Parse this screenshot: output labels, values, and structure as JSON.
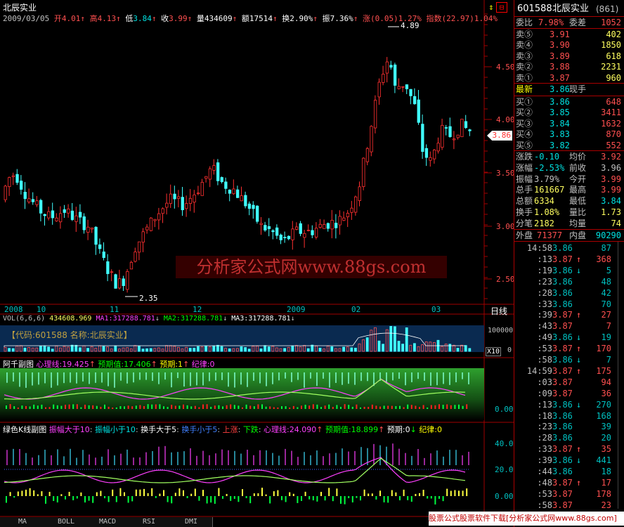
{
  "stock_name": "北辰实业",
  "header": {
    "date": "2009/03/05",
    "open_label": "开",
    "open": "4.01",
    "high_label": "高",
    "high": "4.13",
    "low_label": "低",
    "low": "3.84",
    "close_label": "收",
    "close": "3.99",
    "vol_label": "量",
    "vol": "434609",
    "amt_label": "额",
    "amt": "17514",
    "turn_label": "换",
    "turn": "2.90%",
    "amp_label": "振",
    "amp": "7.36%",
    "chg_label": "涨",
    "chg": "(0.05)",
    "chg_pct": "1.27%",
    "index_label": "指数",
    "index": "(22.97)",
    "index_pct": "1.04%"
  },
  "price_axis": [
    "4.50",
    "4.00",
    "3.50",
    "3.00",
    "2.50"
  ],
  "price_current": "3.86",
  "high_annot": "4.89",
  "low_annot": "2.35",
  "watermark": "分析家公式网www.88gs.com",
  "date_labels": [
    "2008",
    "10",
    "11",
    "12",
    "2009",
    "02",
    "03"
  ],
  "period_label": "日线",
  "vol_panel": {
    "title": "VOL(6,6,6)",
    "vol": "434608.969",
    "ma1_label": "MA1:",
    "ma1": "317288.781",
    "ma2_label": "MA2:",
    "ma2": "317288.781",
    "ma3_label": "MA3:",
    "ma3": "317288.781",
    "info": "【代码:601588 名称:北辰实业】",
    "axis_top": "100000",
    "axis_bottom": "0",
    "unit": "X10"
  },
  "ind1": {
    "name": "阿千副图",
    "l1": "心理线:19.425",
    "l2": "预期值:17.406",
    "l3": "预期:1",
    "l4": "纪律:0",
    "axis": "0.00"
  },
  "ind2": {
    "name": "绿色K线副图",
    "l1": "振幅大于10",
    "l2": "振幅小于10",
    "l3": "换手大于5",
    "l4": "换手小于5",
    "l5": "上涨",
    "l6": "下跌",
    "l7": "心理线:24.090",
    "l8": "预期值:18.899",
    "l9": "预期:0",
    "l10": "纪律:0",
    "axis": [
      "40.00",
      "20.00",
      "0.00"
    ]
  },
  "panel": {
    "code": "601588",
    "name": "北辰实业",
    "num": "(861)",
    "webi_label": "委比",
    "webi": "7.98%",
    "weicha_label": "委差",
    "weicha": "1052",
    "asks": [
      {
        "label": "卖⑤",
        "price": "3.91",
        "vol": "402"
      },
      {
        "label": "卖④",
        "price": "3.90",
        "vol": "1850"
      },
      {
        "label": "卖③",
        "price": "3.89",
        "vol": "618"
      },
      {
        "label": "卖②",
        "price": "3.88",
        "vol": "2231"
      },
      {
        "label": "卖①",
        "price": "3.87",
        "vol": "960"
      }
    ],
    "latest_label": "最新",
    "latest": "3.86",
    "xianshou_label": "现手",
    "bids": [
      {
        "label": "买①",
        "price": "3.86",
        "vol": "648"
      },
      {
        "label": "买②",
        "price": "3.85",
        "vol": "3411"
      },
      {
        "label": "买③",
        "price": "3.84",
        "vol": "1632"
      },
      {
        "label": "买④",
        "price": "3.83",
        "vol": "870"
      },
      {
        "label": "买⑤",
        "price": "3.82",
        "vol": "552"
      }
    ],
    "stats": [
      {
        "l1": "涨跌",
        "v1": "-0.10",
        "l2": "均价",
        "v2": "3.92"
      },
      {
        "l1": "涨幅",
        "v1": "-2.53%",
        "l2": "前收",
        "v2": "3.96"
      },
      {
        "l1": "振幅",
        "v1": "3.79%",
        "l2": "今开",
        "v2": "3.99"
      },
      {
        "l1": "总手",
        "v1": "161667",
        "l2": "最高",
        "v2": "3.99"
      },
      {
        "l1": "总额",
        "v1": "6334",
        "l2": "最低",
        "v2": "3.84"
      },
      {
        "l1": "换手",
        "v1": "1.08%",
        "l2": "量比",
        "v2": "1.73"
      },
      {
        "l1": "分笔",
        "v1": "2182",
        "l2": "均量",
        "v2": "74"
      }
    ],
    "waipan_label": "外盘",
    "waipan": "71377",
    "neipan_label": "内盘",
    "neipan": "90290",
    "ticks": [
      {
        "t": "14:58",
        "p": "3.86",
        "a": "",
        "v": "87",
        "c": "#00c0c0"
      },
      {
        "t": ":13",
        "p": "3.87",
        "a": "↑",
        "v": "368",
        "c": "#ff5050"
      },
      {
        "t": ":19",
        "p": "3.86",
        "a": "↓",
        "v": "5",
        "c": "#00c0c0"
      },
      {
        "t": ":23",
        "p": "3.86",
        "a": "",
        "v": "48",
        "c": "#00c0c0"
      },
      {
        "t": ":28",
        "p": "3.86",
        "a": "",
        "v": "42",
        "c": "#00c0c0"
      },
      {
        "t": ":33",
        "p": "3.86",
        "a": "",
        "v": "70",
        "c": "#00c0c0"
      },
      {
        "t": ":39",
        "p": "3.87",
        "a": "↑",
        "v": "27",
        "c": "#ff5050"
      },
      {
        "t": ":43",
        "p": "3.87",
        "a": "",
        "v": "7",
        "c": "#ff5050"
      },
      {
        "t": ":49",
        "p": "3.86",
        "a": "↓",
        "v": "19",
        "c": "#00c0c0"
      },
      {
        "t": ":53",
        "p": "3.87",
        "a": "↑",
        "v": "170",
        "c": "#ff5050"
      },
      {
        "t": ":58",
        "p": "3.86",
        "a": "↓",
        "v": "7",
        "c": "#00c0c0"
      },
      {
        "t": "14:59",
        "p": "3.87",
        "a": "↑",
        "v": "175",
        "c": "#ff5050"
      },
      {
        "t": ":03",
        "p": "3.87",
        "a": "",
        "v": "94",
        "c": "#ff5050"
      },
      {
        "t": ":09",
        "p": "3.87",
        "a": "",
        "v": "36",
        "c": "#ff5050"
      },
      {
        "t": ":13",
        "p": "3.86",
        "a": "↓",
        "v": "270",
        "c": "#00c0c0"
      },
      {
        "t": ":18",
        "p": "3.86",
        "a": "",
        "v": "168",
        "c": "#00c0c0"
      },
      {
        "t": ":23",
        "p": "3.86",
        "a": "",
        "v": "39",
        "c": "#00c0c0"
      },
      {
        "t": ":28",
        "p": "3.86",
        "a": "",
        "v": "20",
        "c": "#00c0c0"
      },
      {
        "t": ":33",
        "p": "3.87",
        "a": "↑",
        "v": "35",
        "c": "#ff5050"
      },
      {
        "t": ":39",
        "p": "3.86",
        "a": "↓",
        "v": "441",
        "c": "#00c0c0"
      },
      {
        "t": ":44",
        "p": "3.86",
        "a": "",
        "v": "18",
        "c": "#00c0c0"
      },
      {
        "t": ":48",
        "p": "3.87",
        "a": "↑",
        "v": "17",
        "c": "#ff5050"
      },
      {
        "t": ":53",
        "p": "3.87",
        "a": "",
        "v": "178",
        "c": "#ff5050"
      },
      {
        "t": ":58",
        "p": "3.87",
        "a": "",
        "v": "23",
        "c": "#ff5050"
      },
      {
        "t": "15:00",
        "p": "3.86",
        "a": "↓",
        "v": "0.00",
        "c": "#00c0c0"
      }
    ]
  },
  "tabs": [
    "MA",
    "BOLL",
    "MACD",
    "RSI",
    "DMI"
  ],
  "footer": "股票公式股票软件下载[分析家公式网www.88gs.com]"
}
